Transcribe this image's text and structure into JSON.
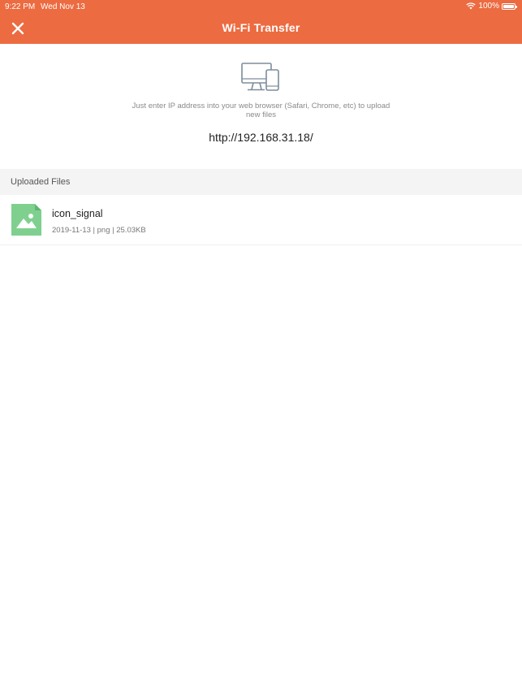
{
  "status_bar": {
    "time": "9:22 PM",
    "date": "Wed Nov 13",
    "battery": "100%"
  },
  "nav": {
    "title": "Wi-Fi Transfer",
    "close_icon": "close-icon"
  },
  "hero": {
    "icon": "devices-icon",
    "hint": "Just enter IP address into your web browser (Safari, Chrome, etc) to upload new files",
    "url": "http://192.168.31.18/"
  },
  "files": {
    "section_title": "Uploaded Files",
    "items": [
      {
        "name": "icon_signal",
        "meta": "2019-11-13 | png | 25.03KB",
        "icon": "image-file-icon"
      }
    ]
  },
  "colors": {
    "accent": "#EC6B41",
    "file_icon": "#7FD08F",
    "section_bg": "#F4F4F4"
  }
}
